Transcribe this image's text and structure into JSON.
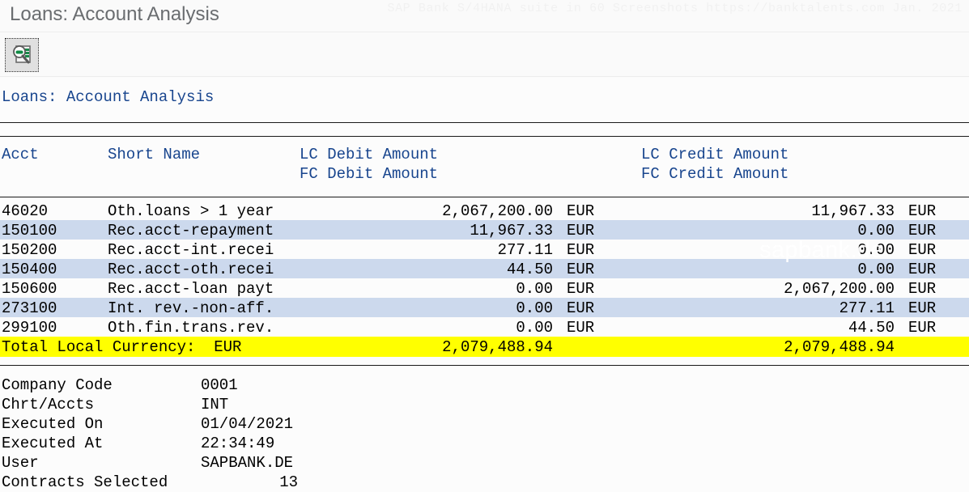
{
  "window": {
    "title": "Loans: Account Analysis"
  },
  "watermarks": {
    "top": "SAP Bank S/4HANA suite in 60 Screenshots  https://banktalents.com Jan. 2021",
    "center": "sapbank.de"
  },
  "toolbar": {
    "buttons": [
      {
        "name": "display-detail-icon",
        "tooltip": "Display Detail"
      }
    ]
  },
  "report": {
    "title": "Loans: Account Analysis",
    "columns": {
      "acct": "Acct",
      "short_name": "Short Name",
      "lc_debit": "LC Debit Amount",
      "fc_debit": "FC Debit Amount",
      "lc_credit": "LC Credit Amount",
      "fc_credit": "FC Credit Amount"
    },
    "rows": [
      {
        "acct": "46020",
        "name": "Oth.loans > 1 year",
        "debit": "2,067,200.00",
        "debit_cur": "EUR",
        "credit": "11,967.33",
        "credit_cur": "EUR"
      },
      {
        "acct": "150100",
        "name": "Rec.acct-repayment",
        "debit": "11,967.33",
        "debit_cur": "EUR",
        "credit": "0.00",
        "credit_cur": "EUR"
      },
      {
        "acct": "150200",
        "name": "Rec.acct-int.recei",
        "debit": "277.11",
        "debit_cur": "EUR",
        "credit": "0.00",
        "credit_cur": "EUR"
      },
      {
        "acct": "150400",
        "name": "Rec.acct-oth.recei",
        "debit": "44.50",
        "debit_cur": "EUR",
        "credit": "0.00",
        "credit_cur": "EUR"
      },
      {
        "acct": "150600",
        "name": "Rec.acct-loan payt",
        "debit": "0.00",
        "debit_cur": "EUR",
        "credit": "2,067,200.00",
        "credit_cur": "EUR"
      },
      {
        "acct": "273100",
        "name": "Int. rev.-non-aff.",
        "debit": "0.00",
        "debit_cur": "EUR",
        "credit": "277.11",
        "credit_cur": "EUR"
      },
      {
        "acct": "299100",
        "name": "Oth.fin.trans.rev.",
        "debit": "0.00",
        "debit_cur": "EUR",
        "credit": "44.50",
        "credit_cur": "EUR"
      }
    ],
    "total": {
      "label": "Total Local Currency:  EUR",
      "debit": "2,079,488.94",
      "credit": "2,079,488.94"
    }
  },
  "footer": [
    {
      "label": "Company Code",
      "value": "0001",
      "numeric": false
    },
    {
      "label": "Chrt/Accts",
      "value": "INT",
      "numeric": false
    },
    {
      "label": "Executed On",
      "value": "01/04/2021",
      "numeric": false
    },
    {
      "label": "Executed At",
      "value": "22:34:49",
      "numeric": false
    },
    {
      "label": "User",
      "value": "SAPBANK.DE",
      "numeric": false
    },
    {
      "label": "Contracts Selected",
      "value": "13",
      "numeric": true
    }
  ],
  "colors": {
    "header_text": "#18458e",
    "row_alt": "#ccd9ed",
    "total_row": "#ffff00",
    "title_text": "#6a6d70"
  }
}
